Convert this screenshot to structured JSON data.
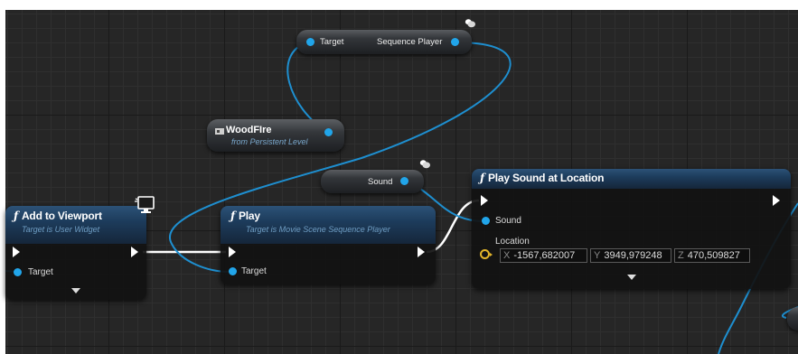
{
  "nodes": {
    "add_to_viewport": {
      "title": "Add to Viewport",
      "subtitle": "Target is User Widget",
      "target_label": "Target"
    },
    "play": {
      "title": "Play",
      "subtitle": "Target is Movie Scene Sequence Player",
      "target_label": "Target"
    },
    "play_sound": {
      "title": "Play Sound at Location",
      "sound_label": "Sound",
      "location_label": "Location",
      "location": {
        "x_axis": "X",
        "x": "-1567,682007",
        "y_axis": "Y",
        "y": "3949,979248",
        "z_axis": "Z",
        "z": "470,509827"
      }
    },
    "sequence_player": {
      "in_label": "Target",
      "out_label": "Sequence Player"
    },
    "woodfire": {
      "title": "WoodFIre",
      "subtitle": "from Persistent Level"
    },
    "sound_var": {
      "label": "Sound"
    }
  },
  "colors": {
    "graph_background": "#262626",
    "node_header": "#1d3c5c",
    "object_pin": "#21a5ea",
    "vector_pin": "#e3b62a",
    "exec_wire": "#ffffff"
  },
  "icons": [
    "function-icon",
    "exec-pin-icon",
    "object-pin-icon",
    "vector-pin-icon",
    "expand-caret-icon",
    "context-cloud-icon",
    "widget-monitor-icon",
    "actor-reference-icon"
  ]
}
